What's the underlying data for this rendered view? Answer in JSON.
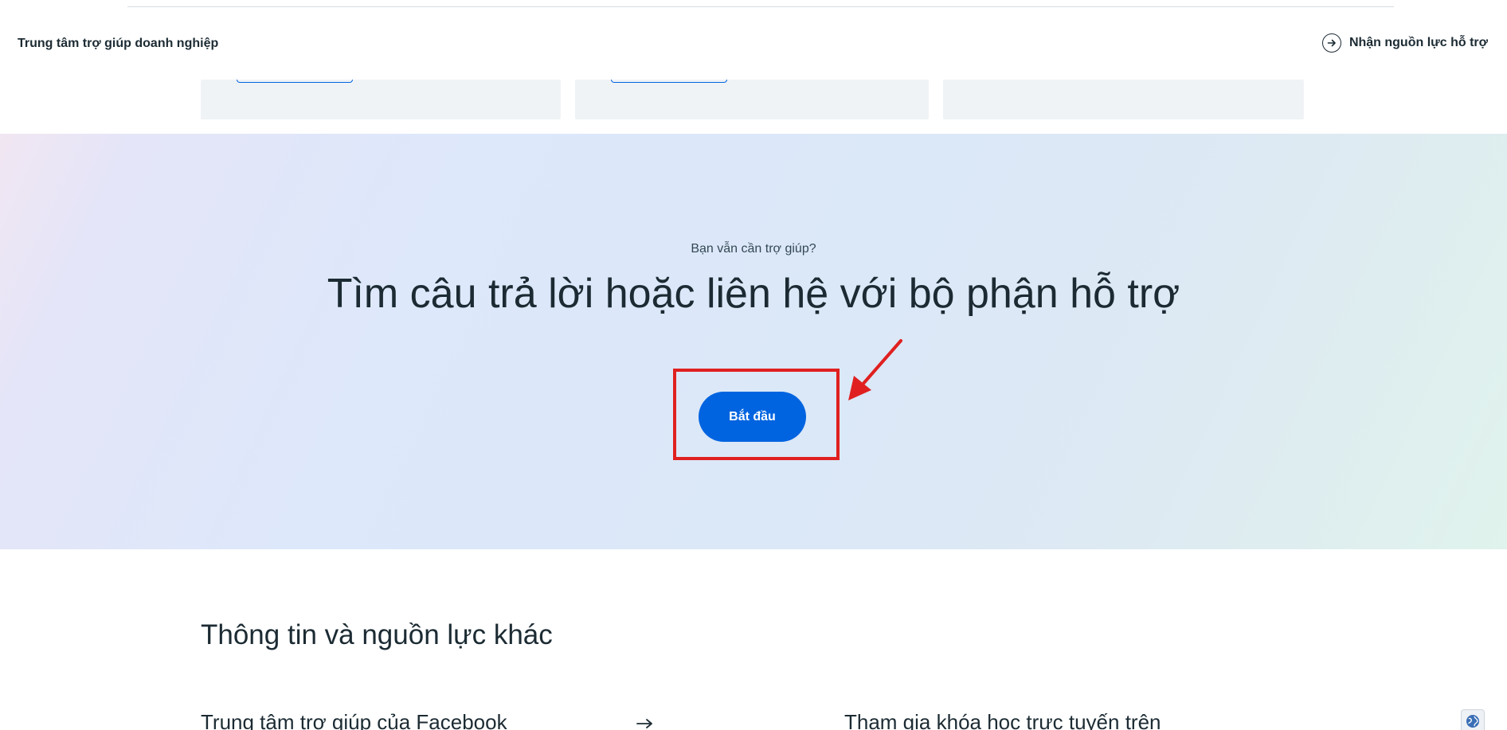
{
  "header": {
    "brand": "Trung tâm trợ giúp doanh nghiệp",
    "resource_link": "Nhận nguồn lực hỗ trợ"
  },
  "hero": {
    "eyebrow": "Bạn vẫn cần trợ giúp?",
    "title": "Tìm câu trả lời hoặc liên hệ với bộ phận hỗ trợ",
    "start_button": "Bắt đầu"
  },
  "resources": {
    "title": "Thông tin và nguồn lực khác",
    "items": [
      {
        "label": "Trung tâm trợ giúp của Facebook"
      },
      {
        "label": "Tham gia khóa học trực tuyến trên"
      }
    ]
  },
  "colors": {
    "accent": "#0064e0",
    "annotation": "#e02020",
    "text": "#1c2b33"
  },
  "icons": [
    "circle-arrow-icon",
    "arrow-right-icon",
    "globe-icon",
    "annotation-arrow"
  ]
}
